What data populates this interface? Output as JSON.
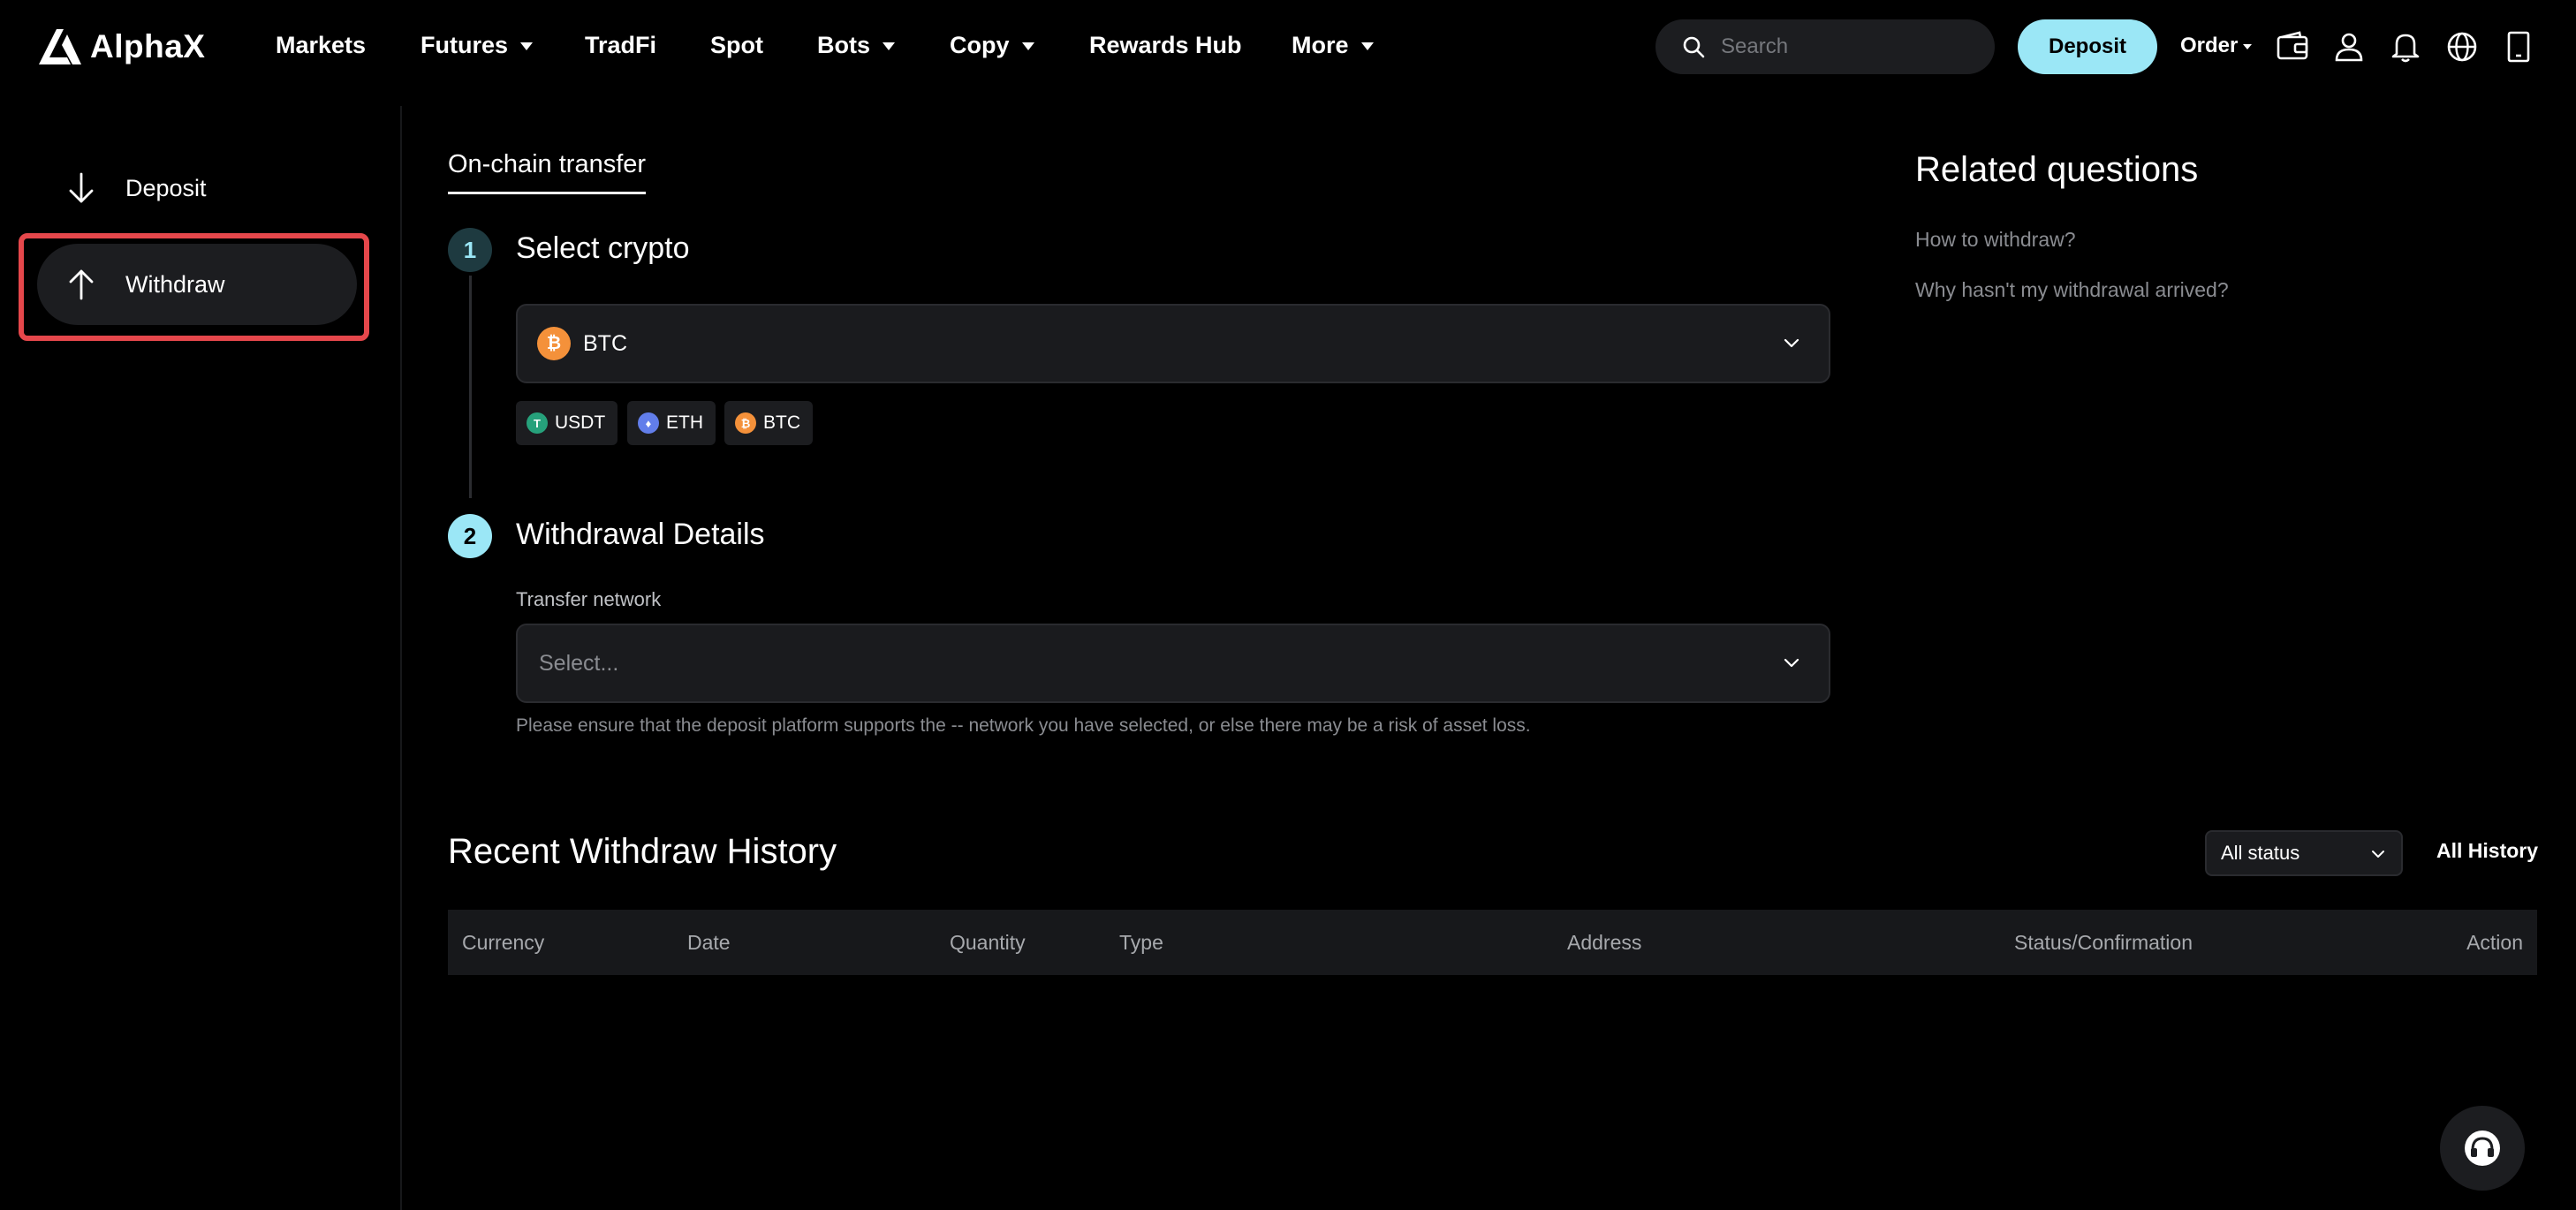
{
  "header": {
    "logo_text": "AlphaX",
    "nav": {
      "markets": "Markets",
      "futures": "Futures",
      "tradfi": "TradFi",
      "spot": "Spot",
      "bots": "Bots",
      "copy": "Copy",
      "rewards": "Rewards Hub",
      "more": "More"
    },
    "search_placeholder": "Search",
    "deposit_label": "Deposit",
    "order_label": "Order",
    "icons": [
      "wallet-icon",
      "user-icon",
      "bell-icon",
      "globe-icon",
      "download-app-icon"
    ]
  },
  "sidebar": {
    "deposit": "Deposit",
    "withdraw": "Withdraw",
    "active": "withdraw"
  },
  "main": {
    "tab": "On-chain transfer",
    "step1": {
      "number": "1",
      "title": "Select crypto",
      "selected": "BTC",
      "quick_coins": {
        "usdt": "USDT",
        "eth": "ETH",
        "btc": "BTC"
      }
    },
    "step2": {
      "number": "2",
      "title": "Withdrawal Details",
      "network_label": "Transfer network",
      "network_placeholder": "Select...",
      "hint": "Please ensure that the deposit platform supports the -- network you have selected, or else there may be a risk of asset loss."
    }
  },
  "related": {
    "title": "Related questions",
    "q1": "How to withdraw?",
    "q2": "Why hasn't my withdrawal arrived?"
  },
  "history": {
    "title": "Recent Withdraw History",
    "status_filter": "All status",
    "all_history": "All History",
    "columns": {
      "currency": "Currency",
      "date": "Date",
      "quantity": "Quantity",
      "type": "Type",
      "address": "Address",
      "status": "Status/Confirmation",
      "action": "Action"
    }
  },
  "colors": {
    "accent": "#9be7f6",
    "background": "#000000",
    "panel": "#1a1b1e",
    "highlight": "#e5474b",
    "btc": "#f4913a",
    "eth": "#627eea",
    "usdt": "#26a17b"
  }
}
